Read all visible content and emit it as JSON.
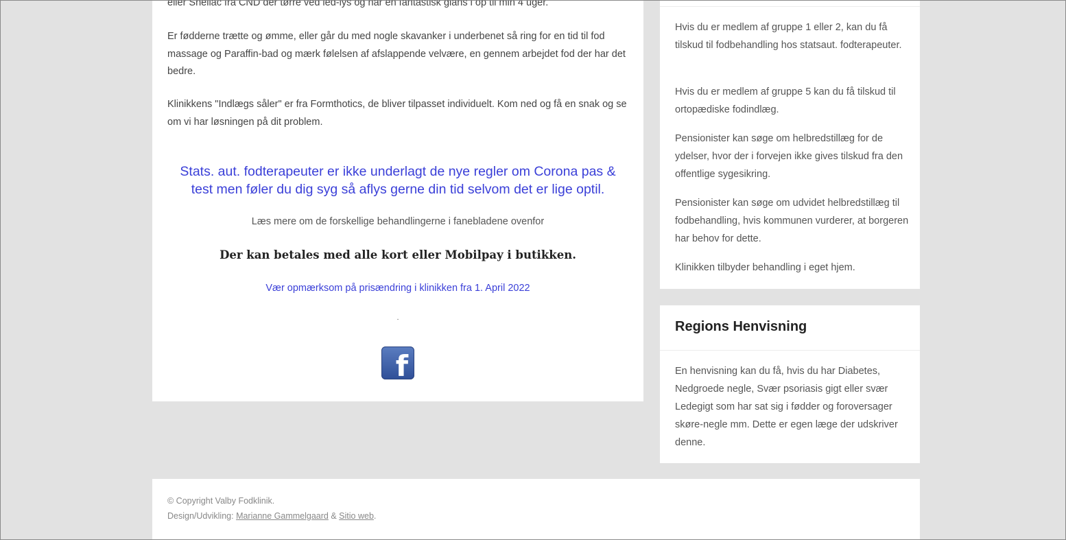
{
  "main": {
    "para_top": "eller Shellac fra CND der tørre ved led-lys og har en fantastisk glans i op til min 4 uger.",
    "para_feet": "Er fødderne trætte og ømme, eller går du med nogle skavanker i underbenet så ring for  en tid til fod massage og Paraffin-bad og mærk følelsen af afslappende velvære, en gennem arbejdet  fod der har det bedre.",
    "para_insoles": "Klinikkens  \"Indlægs såler\" er fra Formthotics, de bliver tilpasset individuelt. Kom ned og få en snak og se om vi har løsningen på dit problem.",
    "corona_notice": "Stats. aut. fodterapeuter er ikke underlagt de nye regler om Corona pas & test men føler du dig syg så aflys gerne din tid selvom det er lige optil.",
    "read_more": "Læs mere om de forskellige behandlingerne i fanebladene ovenfor",
    "payment": "Der kan betales med alle kort eller Mobilpay i butikken.",
    "price_notice": "Vær opmærksom på prisændring i klinikken fra 1. April 2022",
    "dot": ".",
    "facebook_icon": "f"
  },
  "sidebar": {
    "subsidy": {
      "p1": "Hvis du er medlem af gruppe 1 eller 2, kan du få tilskud til fodbehandling hos statsaut. fodterapeuter.",
      "p2": "Hvis du er medlem af gruppe 5 kan du få tilskud til ortopædiske fodindlæg.",
      "p3": "Pensionister kan søge om helbredstillæg for de ydelser, hvor der i forvejen ikke gives tilskud fra den offentlige sygesikring.",
      "p4": "Pensionister kan søge om udvidet helbredstillæg til fodbehandling, hvis kommunen vurderer, at borgeren har behov for dette.",
      "p5": "Klinikken tilbyder behandling i eget hjem."
    },
    "referral": {
      "title": "Regions Henvisning",
      "text": "En henvisning kan du få, hvis du har Diabetes, Nedgroede negle, Svær psoriasis gigt eller svær Ledegigt som har sat sig i fødder og foroversager skøre-negle mm. Dette er egen læge der udskriver denne."
    }
  },
  "footer": {
    "copyright": "© Copyright Valby Fodklinik.",
    "design_label": "Design/Udvikling:",
    "designer": "Marianne Gammelgaard",
    "amp": "&",
    "agency": "Sitio web",
    "period": "."
  },
  "colors": {
    "link_blue": "#3a3fd8",
    "page_bg": "#e2e2e2",
    "facebook_blue": "#3b5998"
  }
}
